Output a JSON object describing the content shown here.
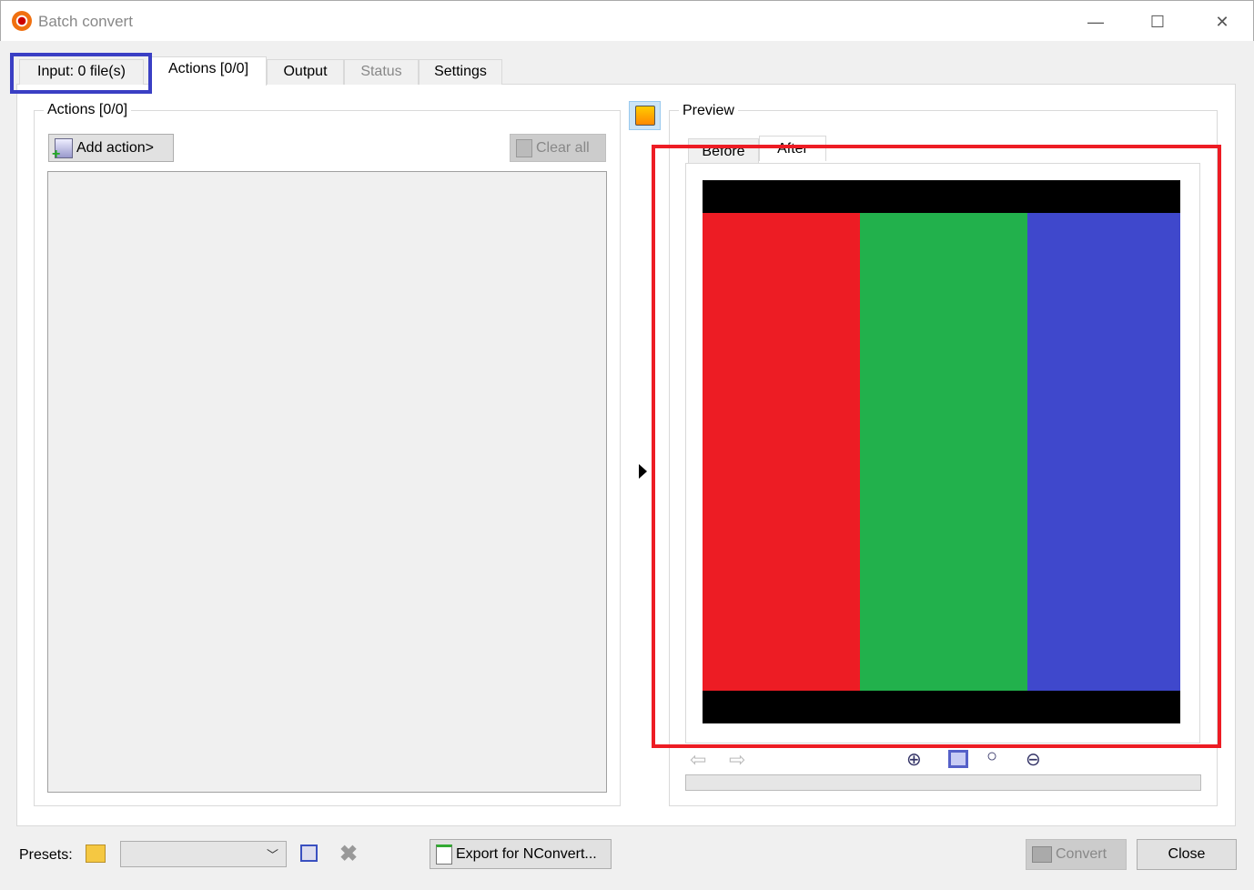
{
  "window": {
    "title": "Batch convert",
    "minimize": "—",
    "maximize": "☐",
    "close": "✕"
  },
  "tabs": [
    {
      "label": "Input: 0 file(s)"
    },
    {
      "label": "Actions [0/0]"
    },
    {
      "label": "Output"
    },
    {
      "label": "Status"
    },
    {
      "label": "Settings"
    }
  ],
  "actions": {
    "group_label": "Actions [0/0]",
    "add_action": "Add action>",
    "clear_all": "Clear all"
  },
  "preview": {
    "group_label": "Preview",
    "tabs": [
      {
        "label": "Before"
      },
      {
        "label": "After"
      }
    ],
    "image_colors": [
      "#000000",
      "#ed1c24",
      "#22b14c",
      "#3f48cc"
    ]
  },
  "footer": {
    "presets_label": "Presets:",
    "preset_value": "",
    "export": "Export for NConvert...",
    "convert": "Convert",
    "close": "Close"
  },
  "highlights": {
    "blue": "#3a3fc4",
    "red": "#ed1c24"
  }
}
